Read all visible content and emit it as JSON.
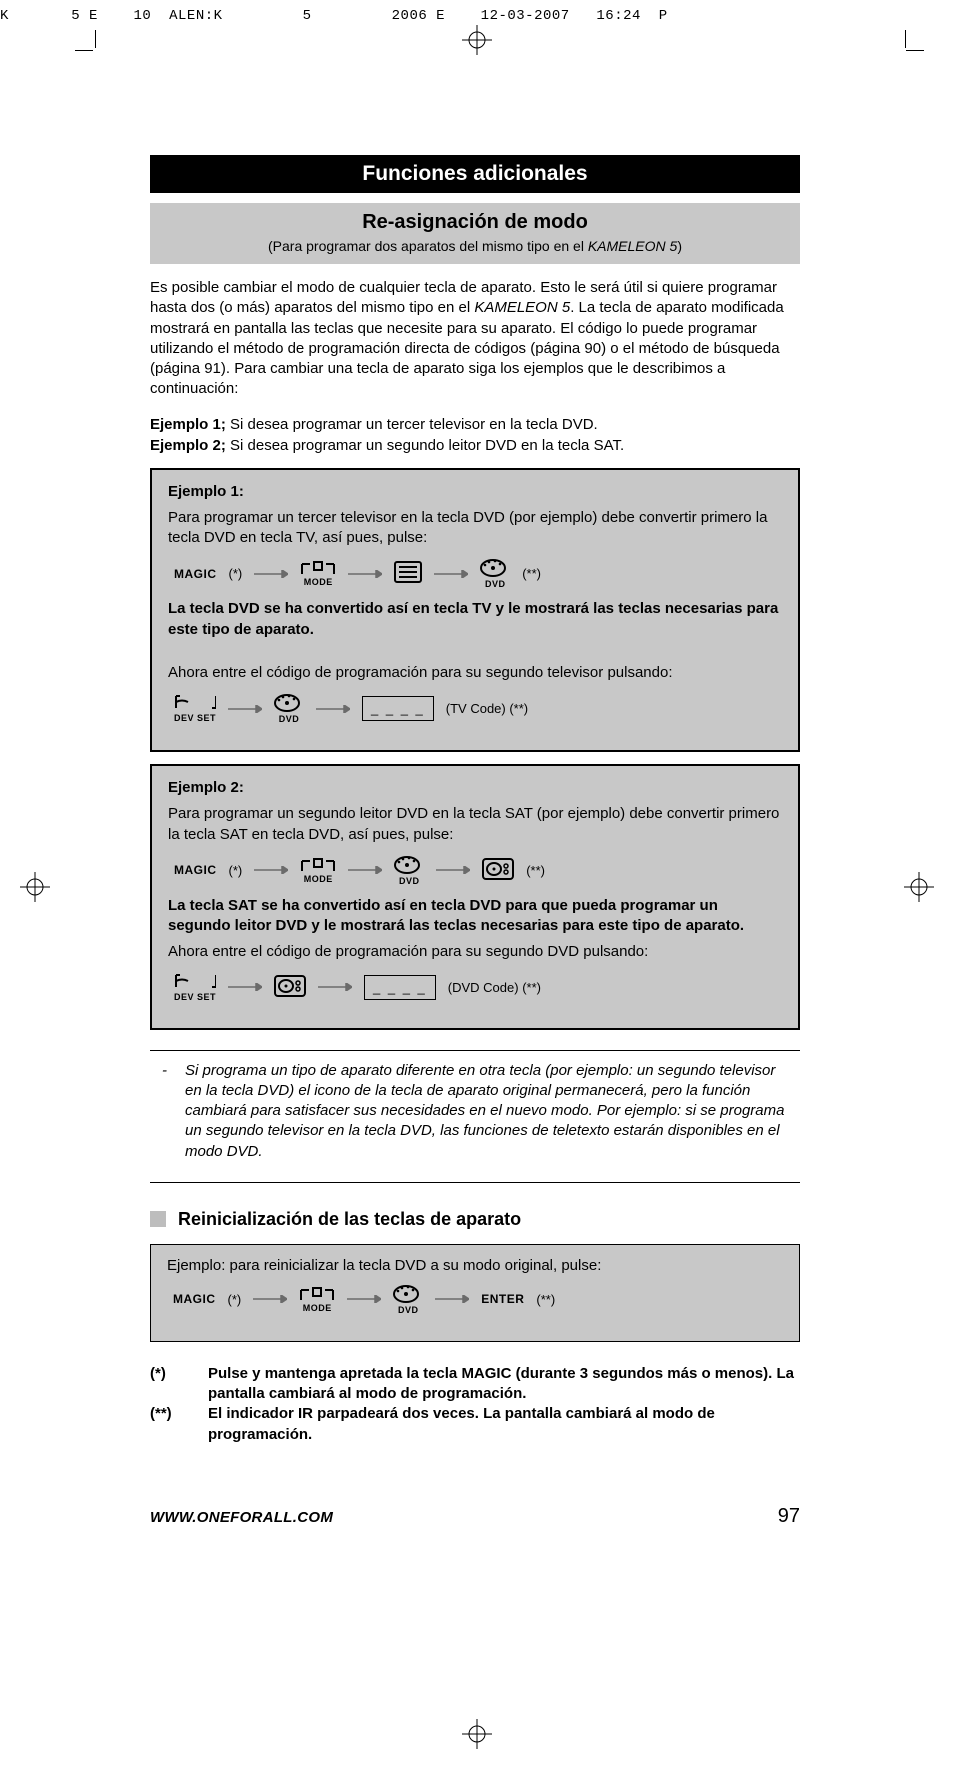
{
  "header_meta": "K       5 E    10  ALEN:K         5         2006 E    12-03-2007   16:24  P",
  "banner_title": "Funciones adicionales",
  "sub_banner": {
    "title": "Re-asignación de modo",
    "para": "(Para programar dos aparatos del mismo tipo en el KAMELEON 5)",
    "para_prefix": "(Para programar dos aparatos del mismo tipo en el ",
    "para_italic": "KAMELEON 5",
    "para_suffix": ")"
  },
  "body_para_1": "Es posible cambiar el modo de cualquier tecla de aparato. Esto le será útil si quiere programar hasta dos (o más) aparatos del mismo tipo en el ",
  "body_para_1_italic": "KAMELEON 5",
  "body_para_1_cont": ". La tecla de aparato modificada mostrará en pantalla las teclas que necesite para su aparato. El código lo puede programar utilizando el método de programación directa de códigos (página 90) o el método de búsqueda (página 91). Para cambiar una tecla de aparato siga los ejemplos que le describimos a continuación:",
  "intro_ex1_bold": "Ejemplo 1;",
  "intro_ex1": " Si desea programar un tercer televisor en la tecla DVD.",
  "intro_ex2_bold": "Ejemplo 2;",
  "intro_ex2": " Si desea programar un segundo leitor DVD en la tecla SAT.",
  "example1": {
    "title": "Ejemplo 1:",
    "p1": "Para programar un tercer televisor en la tecla DVD (por ejemplo) debe convertir primero la tecla DVD en tecla TV, así pues, pulse:",
    "result": "La tecla DVD se ha convertido así en tecla TV y le mostrará las teclas necesarias para este tipo de aparato.",
    "p2": "Ahora entre el código de programación para su segundo televisor pulsando:",
    "code_hint": "(TV Code)  (**)"
  },
  "example2": {
    "title": "Ejemplo 2:",
    "p1": "Para programar un segundo leitor DVD en la tecla SAT (por ejemplo) debe convertir primero la tecla SAT en tecla DVD, así pues, pulse:",
    "result": "La tecla SAT se ha convertido así en tecla DVD para que pueda programar un segundo leitor DVD y le mostrará las teclas necesarias para este tipo de aparato.",
    "p2": "Ahora entre el código de programación para su segundo DVD pulsando:",
    "code_hint": "(DVD Code) (**)"
  },
  "labels": {
    "magic": "MAGIC",
    "mode": "MODE",
    "devset": "DEV SET",
    "enter": "ENTER",
    "dvd": "DVD",
    "ast": "(*)",
    "ast2": "(**)",
    "dashes": "_ _ _ _"
  },
  "note_dash": "-",
  "note": "Si programa un tipo de aparato diferente en otra tecla (por ejemplo: un segundo televisor en la tecla DVD) el icono de la tecla de aparato original permanecerá, pero la función cambiará para satisfacer sus necesidades en el nuevo modo. Por ejemplo: si se programa un segundo televisor en la tecla DVD, las funciones de teletexto estarán disponibles en el modo DVD.",
  "reinit_title": "Reinicialización de las teclas de aparato",
  "reinit_p": "Ejemplo: para reinicializar la tecla DVD a su modo original, pulse:",
  "foot1_sym": "(*)",
  "foot1": "Pulse y mantenga apretada la tecla MAGIC (durante 3 segundos más o menos). La pantalla cambiará al modo de programación.",
  "foot2_sym": "(**)",
  "foot2": "El indicador IR parpadeará dos veces. La pantalla cambiará al modo de programación.",
  "url": "WWW.ONEFORALL.COM",
  "page_no": "97"
}
